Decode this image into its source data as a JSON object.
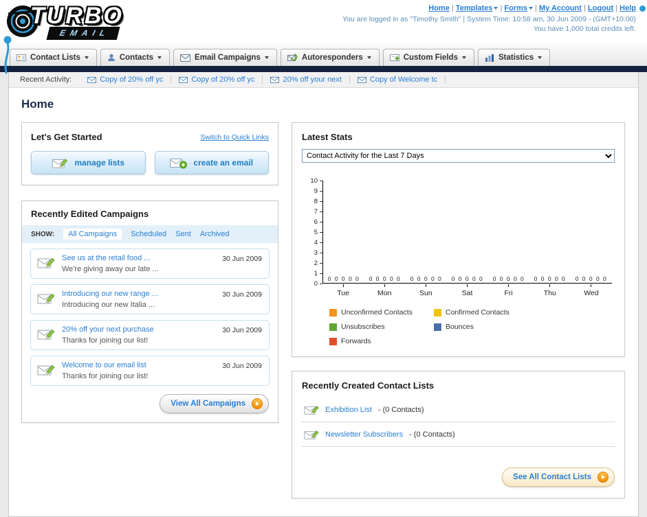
{
  "ui": {
    "separator": "|"
  },
  "colors": {
    "accent_blue": "#2a7fd4",
    "navy_bar": "#14203e",
    "orange": "#f59b1e"
  },
  "header": {
    "logo": {
      "line1": "TURBO",
      "line2": "EMAIL"
    },
    "nav_items": [
      {
        "label": "Home"
      },
      {
        "label": "Templates"
      },
      {
        "label": "Forms"
      },
      {
        "label": "My Account"
      },
      {
        "label": "Logout"
      },
      {
        "label": "Help"
      }
    ],
    "login_info": "You are logged in as \"Timothy Smith\" | System Time: 10:58 am, 30 Jun 2009 - (GMT+10:00)",
    "credits_info": "You have 1,000 total credits left."
  },
  "tabs": [
    {
      "label": "Contact Lists"
    },
    {
      "label": "Contacts"
    },
    {
      "label": "Email Campaigns"
    },
    {
      "label": "Autoresponders"
    },
    {
      "label": "Custom Fields"
    },
    {
      "label": "Statistics"
    }
  ],
  "activity": {
    "label": "Recent Activity:",
    "items": [
      "Copy of 20% off yc",
      "Copy of 20% off yc",
      "20% off your next",
      "Copy of Welcome tc"
    ]
  },
  "page": {
    "title": "Home"
  },
  "get_started": {
    "title": "Let's Get Started",
    "switch_link": "Switch to Quick Links",
    "manage_lists_label": "manage lists",
    "create_email_label": "create an email"
  },
  "campaigns": {
    "title": "Recently Edited Campaigns",
    "show_label": "SHOW:",
    "filters": [
      {
        "label": "All Campaigns"
      },
      {
        "label": "Scheduled"
      },
      {
        "label": "Sent"
      },
      {
        "label": "Archived"
      }
    ],
    "items": [
      {
        "title": "See us at the retail food ...",
        "subtitle": "We're giving away our late ...",
        "date": "30 Jun 2009"
      },
      {
        "title": "Introducing our new range ...",
        "subtitle": "Introducing our new Italia ...",
        "date": "30 Jun 2009"
      },
      {
        "title": "20% off your next purchase",
        "subtitle": "Thanks for joining our list!",
        "date": "30 Jun 2009"
      },
      {
        "title": "Welcome to our email list",
        "subtitle": "Thanks for joining our list!",
        "date": "30 Jun 2009"
      }
    ],
    "view_all_label": "View All Campaigns"
  },
  "latest_stats": {
    "title": "Latest Stats",
    "dropdown_value": "Contact Activity for the Last 7 Days",
    "chart_data": {
      "type": "bar",
      "title": "Contact Activity for the Last 7 Days",
      "categories": [
        "Tue",
        "Mon",
        "Sun",
        "Sat",
        "Fri",
        "Thu",
        "Wed"
      ],
      "series": [
        {
          "name": "Unconfirmed Contacts",
          "color": "#f5941e",
          "values": [
            0,
            0,
            0,
            0,
            0,
            0,
            0
          ]
        },
        {
          "name": "Confirmed Contacts",
          "color": "#f0c413",
          "values": [
            0,
            0,
            0,
            0,
            0,
            0,
            0
          ]
        },
        {
          "name": "Unsubscribes",
          "color": "#62a730",
          "values": [
            0,
            0,
            0,
            0,
            0,
            0,
            0
          ]
        },
        {
          "name": "Bounces",
          "color": "#4d6fa8",
          "values": [
            0,
            0,
            0,
            0,
            0,
            0,
            0
          ]
        },
        {
          "name": "Forwards",
          "color": "#e2502b",
          "values": [
            0,
            0,
            0,
            0,
            0,
            0,
            0
          ]
        }
      ],
      "ylim": [
        0,
        10
      ],
      "ytick_step": 1,
      "grid": false,
      "legend_position": "bottom"
    }
  },
  "contact_lists": {
    "title": "Recently Created Contact Lists",
    "items": [
      {
        "name": "Exhibition List",
        "detail": "- (0 Contacts)"
      },
      {
        "name": "Newsletter Subscribers",
        "detail": "- (0 Contacts)"
      }
    ],
    "see_all_label": "See All Contact Lists"
  }
}
